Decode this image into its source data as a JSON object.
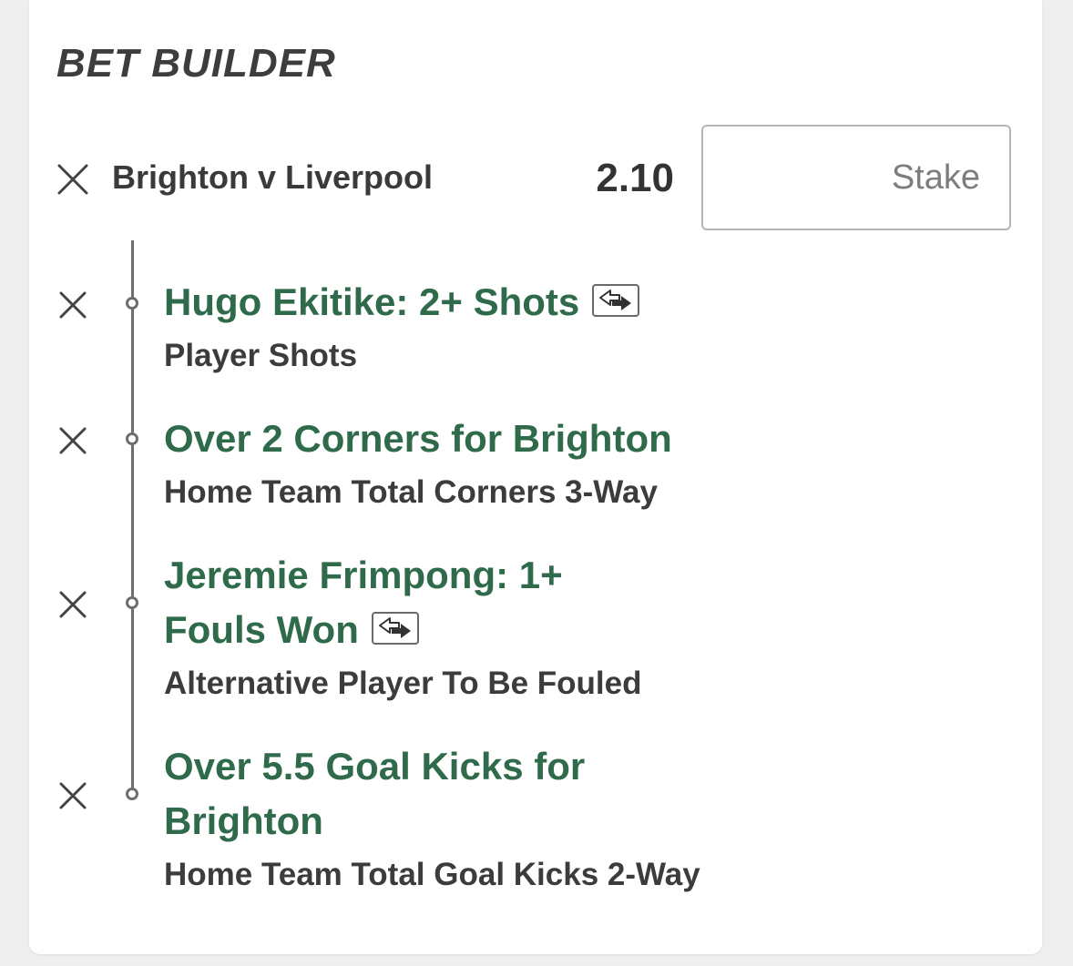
{
  "header": {
    "title": "BET BUILDER"
  },
  "match": {
    "name": "Brighton v Liverpool",
    "odds": "2.10",
    "stake_placeholder": "Stake"
  },
  "selections": [
    {
      "title_line1": "Hugo Ekitike: 2+ Shots",
      "title_line2": "",
      "market": "Player Shots",
      "has_swap_icon": true
    },
    {
      "title_line1": "Over 2 Corners for Brighton",
      "title_line2": "",
      "market": "Home Team Total Corners 3-Way",
      "has_swap_icon": false
    },
    {
      "title_line1": "Jeremie Frimpong: 1+",
      "title_line2": "Fouls Won",
      "market": "Alternative Player To Be Fouled",
      "has_swap_icon": true
    },
    {
      "title_line1": "Over 5.5 Goal Kicks for",
      "title_line2": "Brighton",
      "market": "Home Team Total Goal Kicks 2-Way",
      "has_swap_icon": false
    }
  ],
  "icons": {
    "remove": "close-icon",
    "swap": "swap-icon",
    "timeline": "timeline-node-icon"
  },
  "colors": {
    "selection_title": "#2f6b4a",
    "text_dark": "#3a3a3a",
    "background": "#efefef",
    "card": "#ffffff"
  }
}
